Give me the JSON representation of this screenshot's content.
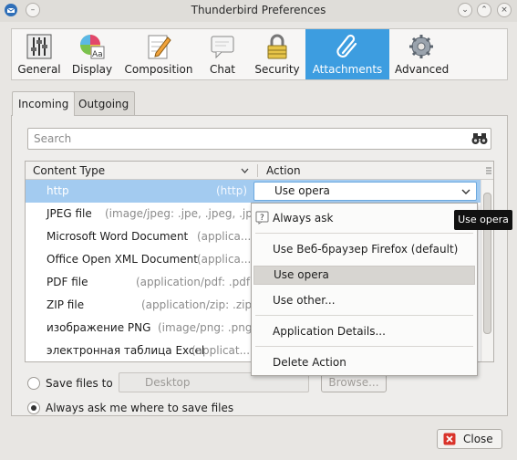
{
  "window": {
    "title": "Thunderbird Preferences"
  },
  "toolbar": {
    "categories": [
      {
        "label": "General",
        "icon": "sliders-icon"
      },
      {
        "label": "Display",
        "icon": "palette-icon"
      },
      {
        "label": "Composition",
        "icon": "pencil-paper-icon"
      },
      {
        "label": "Chat",
        "icon": "chat-bubble-icon"
      },
      {
        "label": "Security",
        "icon": "padlock-icon"
      },
      {
        "label": "Attachments",
        "icon": "paperclip-icon"
      },
      {
        "label": "Advanced",
        "icon": "gear-icon"
      }
    ],
    "active": "Attachments",
    "accent_color": "#3d9de0"
  },
  "tabs": [
    {
      "label": "Incoming"
    },
    {
      "label": "Outgoing"
    }
  ],
  "search": {
    "placeholder": "Search"
  },
  "table": {
    "columns": [
      "Content Type",
      "Action"
    ],
    "rows": [
      {
        "type": "http",
        "mime": "(http)"
      },
      {
        "type": "JPEG file",
        "mime": "(image/jpeg: .jpe, .jpeg, .jpg)"
      },
      {
        "type": "Microsoft Word Document",
        "mime": "(applica..."
      },
      {
        "type": "Office Open XML Document",
        "mime": "(applica..."
      },
      {
        "type": "PDF file",
        "mime": "(application/pdf: .pdf)"
      },
      {
        "type": "ZIP file",
        "mime": "(application/zip: .zip)"
      },
      {
        "type": "изображение PNG",
        "mime": "(image/png: .png)"
      },
      {
        "type": "электронная таблица Excel",
        "mime": "(applicat..."
      }
    ],
    "selected_action": "Use opera"
  },
  "menu": {
    "items": [
      "Always ask",
      "Use Веб-браузер Firefox (default)",
      "Use opera",
      "Use other...",
      "Application Details...",
      "Delete Action"
    ],
    "highlighted": "Use opera"
  },
  "tooltip": "Use opera",
  "save": {
    "save_files_to": "Save files to",
    "folder": "Desktop",
    "browse": "Browse...",
    "always_ask": "Always ask me where to save files",
    "selected": "always_ask"
  },
  "buttons": {
    "close": "Close"
  }
}
